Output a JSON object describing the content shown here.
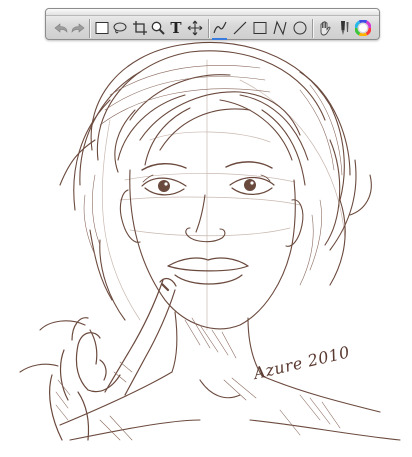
{
  "toolbar": {
    "tools": [
      {
        "name": "undo-icon"
      },
      {
        "name": "redo-icon"
      },
      {
        "name": "rectangle-select-icon"
      },
      {
        "name": "lasso-select-icon"
      },
      {
        "name": "crop-icon"
      },
      {
        "name": "zoom-icon"
      },
      {
        "name": "text-tool-icon",
        "glyph": "T"
      },
      {
        "name": "move-icon"
      },
      {
        "name": "freehand-pen-icon",
        "active": true
      },
      {
        "name": "line-icon"
      },
      {
        "name": "rectangle-shape-icon"
      },
      {
        "name": "polyline-icon"
      },
      {
        "name": "ellipse-shape-icon"
      },
      {
        "name": "hand-pan-icon"
      },
      {
        "name": "pen-brush-icon"
      },
      {
        "name": "color-wheel-icon"
      }
    ],
    "accent_color": "#3a7be0"
  },
  "canvas": {
    "signature": "Azure 2010",
    "stroke_color": "#6b4a3e"
  }
}
